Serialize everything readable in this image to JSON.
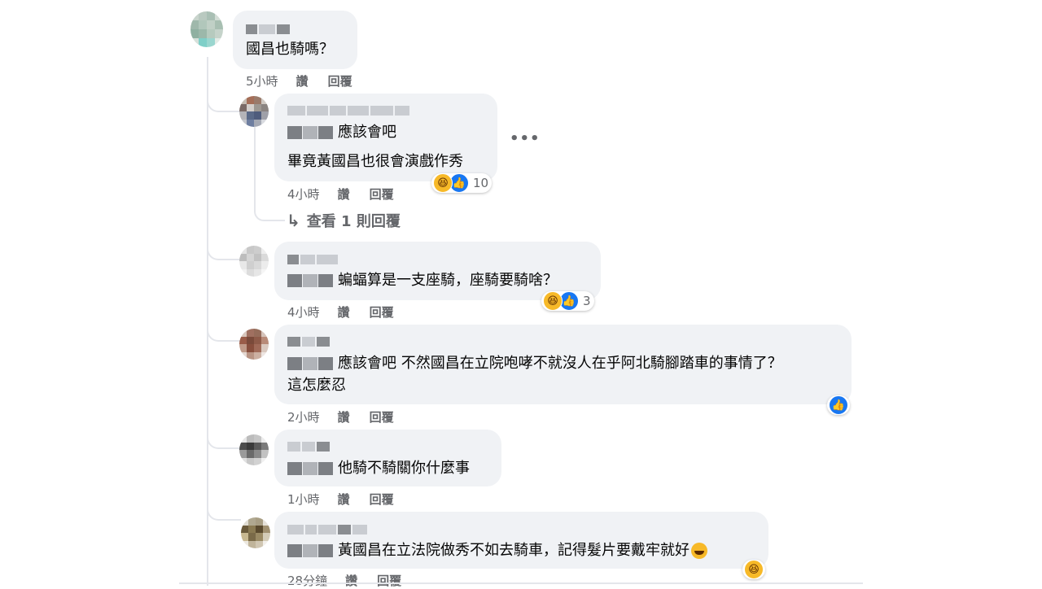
{
  "comments": [
    {
      "id": "c1",
      "text": "國昌也騎嗎？",
      "time": "5小時",
      "like": "讚",
      "reply": "回覆"
    },
    {
      "id": "c2",
      "line1": "應該會吧",
      "line2": "畢竟黃國昌也很會演戲作秀",
      "time": "4小時",
      "like": "讚",
      "reply": "回覆",
      "reaction_count": "10"
    },
    {
      "id": "c3",
      "text": "蝙蝠算是一支座騎，座騎要騎啥？",
      "time": "4小時",
      "like": "讚",
      "reply": "回覆",
      "reaction_count": "3"
    },
    {
      "id": "c4",
      "line1": "應該會吧 不然國昌在立院咆哮不就沒人在乎阿北騎腳踏車的事情了？",
      "line2": "這怎麼忍",
      "time": "2小時",
      "like": "讚",
      "reply": "回覆"
    },
    {
      "id": "c5",
      "text": "他騎不騎關你什麼事",
      "time": "1小時",
      "like": "讚",
      "reply": "回覆"
    },
    {
      "id": "c6",
      "text": "黃國昌在立法院做秀不如去騎車，記得髮片要戴牢就好",
      "time": "28分鐘",
      "like": "讚",
      "reply": "回覆"
    }
  ],
  "view_replies": "查看 1 則回覆",
  "more_label": "•••",
  "icons": {
    "haha": "haha-reaction-icon",
    "like": "like-reaction-icon",
    "reply_arrow": "reply-arrow-icon",
    "more": "more-options-icon"
  },
  "colors": {
    "bubble": "#f0f2f5",
    "meta": "#65676b",
    "like_blue": "#1877f2",
    "haha_yellow": "#f7b928"
  }
}
